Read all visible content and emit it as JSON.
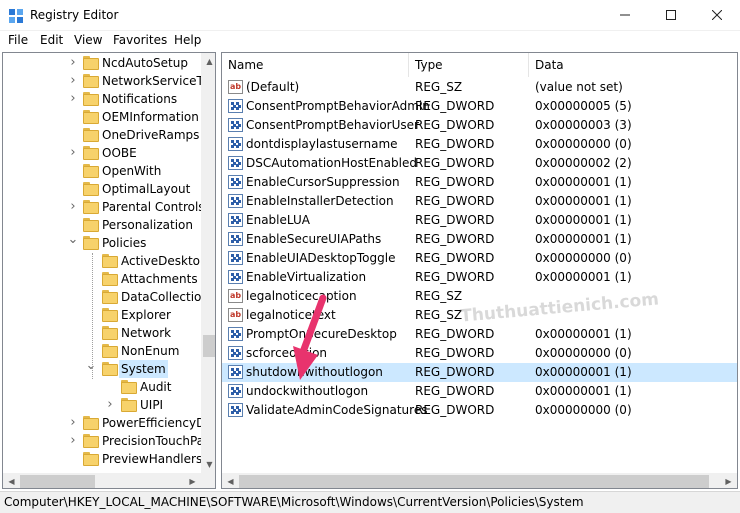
{
  "window": {
    "title": "Registry Editor",
    "minimize": "—",
    "maximize": "☐",
    "close": "✕",
    "icon": "registry-editor-icon"
  },
  "menu": [
    "File",
    "Edit",
    "View",
    "Favorites",
    "Help"
  ],
  "tree": [
    {
      "label": "NcdAutoSetup",
      "expander": "collapsed"
    },
    {
      "label": "NetworkServiceTriggers",
      "expander": "collapsed"
    },
    {
      "label": "Notifications",
      "expander": "collapsed"
    },
    {
      "label": "OEMInformation",
      "expander": "none"
    },
    {
      "label": "OneDriveRamps",
      "expander": "none"
    },
    {
      "label": "OOBE",
      "expander": "collapsed"
    },
    {
      "label": "OpenWith",
      "expander": "none"
    },
    {
      "label": "OptimalLayout",
      "expander": "none"
    },
    {
      "label": "Parental Controls",
      "expander": "collapsed"
    },
    {
      "label": "Personalization",
      "expander": "none"
    },
    {
      "label": "Policies",
      "expander": "expanded"
    },
    {
      "label": "ActiveDesktop",
      "expander": "none"
    },
    {
      "label": "Attachments",
      "expander": "none"
    },
    {
      "label": "DataCollection",
      "expander": "none"
    },
    {
      "label": "Explorer",
      "expander": "none"
    },
    {
      "label": "Network",
      "expander": "none"
    },
    {
      "label": "NonEnum",
      "expander": "none"
    },
    {
      "label": "System",
      "expander": "expanded",
      "selected": true
    },
    {
      "label": "Audit",
      "expander": "none"
    },
    {
      "label": "UIPI",
      "expander": "collapsed"
    },
    {
      "label": "PowerEfficiencyDiagnostics",
      "expander": "collapsed"
    },
    {
      "label": "PrecisionTouchPad",
      "expander": "collapsed"
    },
    {
      "label": "PreviewHandlers",
      "expander": "none"
    }
  ],
  "columns": {
    "name": "Name",
    "type": "Type",
    "data": "Data"
  },
  "values": [
    {
      "name": "(Default)",
      "type": "REG_SZ",
      "data": "(value not set)",
      "icon": "string"
    },
    {
      "name": "ConsentPromptBehaviorAdmin",
      "type": "REG_DWORD",
      "data": "0x00000005 (5)",
      "icon": "binary"
    },
    {
      "name": "ConsentPromptBehaviorUser",
      "type": "REG_DWORD",
      "data": "0x00000003 (3)",
      "icon": "binary"
    },
    {
      "name": "dontdisplaylastusername",
      "type": "REG_DWORD",
      "data": "0x00000000 (0)",
      "icon": "binary"
    },
    {
      "name": "DSCAutomationHostEnabled",
      "type": "REG_DWORD",
      "data": "0x00000002 (2)",
      "icon": "binary"
    },
    {
      "name": "EnableCursorSuppression",
      "type": "REG_DWORD",
      "data": "0x00000001 (1)",
      "icon": "binary"
    },
    {
      "name": "EnableInstallerDetection",
      "type": "REG_DWORD",
      "data": "0x00000001 (1)",
      "icon": "binary"
    },
    {
      "name": "EnableLUA",
      "type": "REG_DWORD",
      "data": "0x00000001 (1)",
      "icon": "binary"
    },
    {
      "name": "EnableSecureUIAPaths",
      "type": "REG_DWORD",
      "data": "0x00000001 (1)",
      "icon": "binary"
    },
    {
      "name": "EnableUIADesktopToggle",
      "type": "REG_DWORD",
      "data": "0x00000000 (0)",
      "icon": "binary"
    },
    {
      "name": "EnableVirtualization",
      "type": "REG_DWORD",
      "data": "0x00000001 (1)",
      "icon": "binary"
    },
    {
      "name": "legalnoticecaption",
      "type": "REG_SZ",
      "data": "",
      "icon": "string"
    },
    {
      "name": "legalnoticetext",
      "type": "REG_SZ",
      "data": "",
      "icon": "string"
    },
    {
      "name": "PromptOnSecureDesktop",
      "type": "REG_DWORD",
      "data": "0x00000001 (1)",
      "icon": "binary"
    },
    {
      "name": "scforceoption",
      "type": "REG_DWORD",
      "data": "0x00000000 (0)",
      "icon": "binary"
    },
    {
      "name": "shutdownwithoutlogon",
      "type": "REG_DWORD",
      "data": "0x00000001 (1)",
      "icon": "binary",
      "selected": true
    },
    {
      "name": "undockwithoutlogon",
      "type": "REG_DWORD",
      "data": "0x00000001 (1)",
      "icon": "binary"
    },
    {
      "name": "ValidateAdminCodeSignatures",
      "type": "REG_DWORD",
      "data": "0x00000000 (0)",
      "icon": "binary"
    }
  ],
  "status": {
    "path": "Computer\\HKEY_LOCAL_MACHINE\\SOFTWARE\\Microsoft\\Windows\\CurrentVersion\\Policies\\System"
  },
  "watermark": "Thuthuattienich.com",
  "colors": {
    "selection": "#cce8ff",
    "annotation_arrow": "#e8336d"
  }
}
